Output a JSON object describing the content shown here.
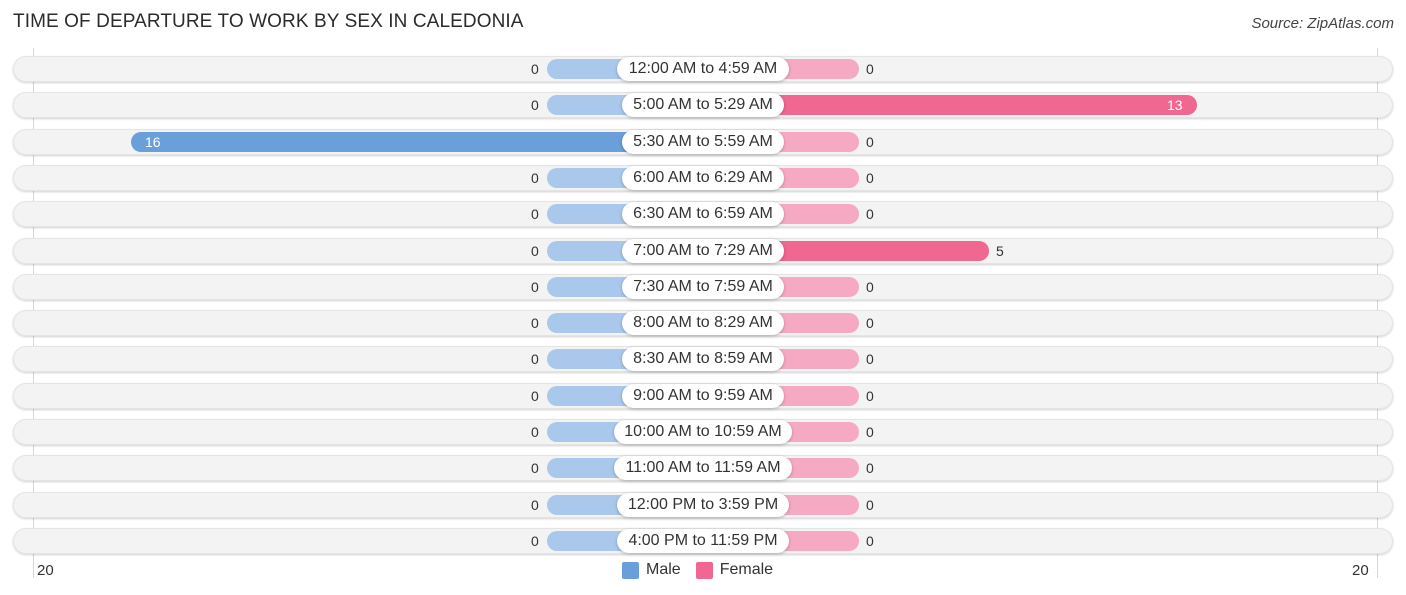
{
  "title": "TIME OF DEPARTURE TO WORK BY SEX IN CALEDONIA",
  "source": "Source: ZipAtlas.com",
  "colors": {
    "male_light": "#a9c8ec",
    "male_strong": "#6a9fda",
    "female_light": "#f6a9c3",
    "female_strong": "#f06792"
  },
  "chart_data": {
    "type": "bar",
    "orientation": "horizontal-diverging",
    "title": "TIME OF DEPARTURE TO WORK BY SEX IN CALEDONIA",
    "categories": [
      "12:00 AM to 4:59 AM",
      "5:00 AM to 5:29 AM",
      "5:30 AM to 5:59 AM",
      "6:00 AM to 6:29 AM",
      "6:30 AM to 6:59 AM",
      "7:00 AM to 7:29 AM",
      "7:30 AM to 7:59 AM",
      "8:00 AM to 8:29 AM",
      "8:30 AM to 8:59 AM",
      "9:00 AM to 9:59 AM",
      "10:00 AM to 10:59 AM",
      "11:00 AM to 11:59 AM",
      "12:00 PM to 3:59 PM",
      "4:00 PM to 11:59 PM"
    ],
    "series": [
      {
        "name": "Male",
        "values": [
          0,
          0,
          16,
          0,
          0,
          0,
          0,
          0,
          0,
          0,
          0,
          0,
          0,
          0
        ]
      },
      {
        "name": "Female",
        "values": [
          0,
          13,
          0,
          0,
          0,
          5,
          0,
          0,
          0,
          0,
          0,
          0,
          0,
          0
        ]
      }
    ],
    "axis": {
      "left_max_label": "20",
      "right_max_label": "20",
      "range": [
        0,
        20
      ]
    },
    "legend": {
      "position": "bottom-center",
      "items": [
        "Male",
        "Female"
      ]
    },
    "grid": false
  }
}
